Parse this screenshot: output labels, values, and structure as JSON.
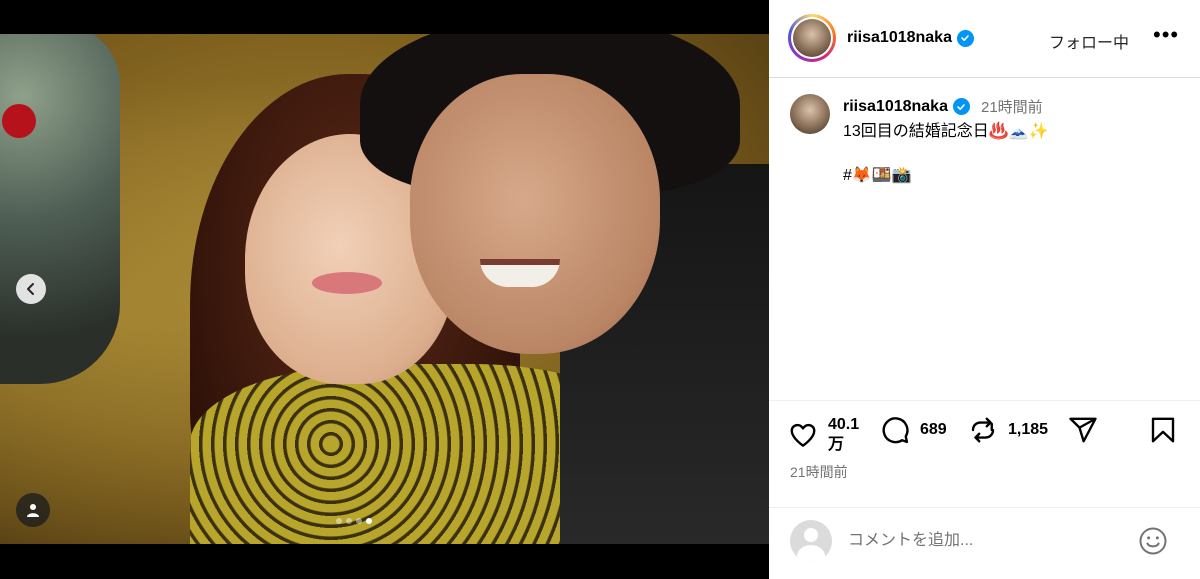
{
  "post": {
    "username": "riisa1018naka",
    "follow_label": "フォロー中",
    "more_label": "•••",
    "caption_username": "riisa1018naka",
    "caption_time": "21時間前",
    "caption_text": "13回目の結婚記念日♨️🗻✨",
    "caption_hashtags": "#🦊🍱📸"
  },
  "media": {
    "carousel_total": 4,
    "carousel_active": 4
  },
  "actions": {
    "likes": "40.1\n万",
    "likes_line1": "40.1",
    "likes_line2": "万",
    "comments": "689",
    "reposts": "1,185",
    "timestamp": "21時間前"
  },
  "comment": {
    "placeholder": "コメントを追加..."
  },
  "colors": {
    "verified": "#0095f6",
    "muted_text": "#737373",
    "border": "#dbdbdb"
  },
  "icons": [
    "chevron-left-icon",
    "person-tag-icon",
    "verified-icon",
    "heart-icon",
    "comment-icon",
    "repost-icon",
    "share-icon",
    "bookmark-icon",
    "emoji-icon"
  ]
}
